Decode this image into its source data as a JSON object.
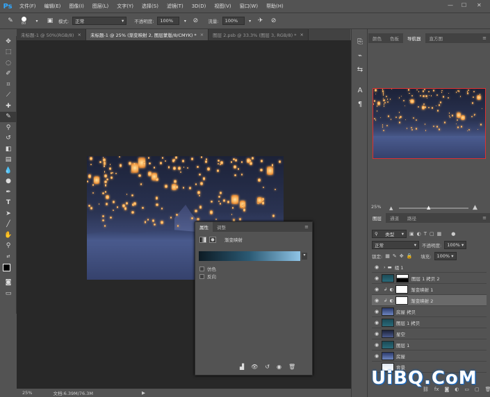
{
  "app": {
    "logo": "Ps"
  },
  "menus": [
    "文件(F)",
    "编辑(E)",
    "图像(I)",
    "图层(L)",
    "文字(Y)",
    "选择(S)",
    "滤镜(T)",
    "3D(D)",
    "视图(V)",
    "窗口(W)",
    "帮助(H)"
  ],
  "window_controls": {
    "minimize": "—",
    "maximize": "☐",
    "close": "✕"
  },
  "options": {
    "brush_size": "80",
    "mode_label": "模式:",
    "mode_value": "正常",
    "opacity_label": "不透明度:",
    "opacity_value": "100%",
    "flow_label": "流量:",
    "flow_value": "100%"
  },
  "doc_tabs": [
    {
      "label": "未标题-1 @ 50%(RGB/8)",
      "close": "×"
    },
    {
      "label": "未标题-1 @ 25% (渐变映射 2, 图层蒙版/8/CMYK) *",
      "close": "×"
    },
    {
      "label": "图层 2.psb @ 33.3% (图层 3, RGB/8) *",
      "close": "×"
    }
  ],
  "status": {
    "zoom": "25%",
    "doc_size": "文档:6.39M/76.3M",
    "arrow": "▶"
  },
  "properties": {
    "tabs": [
      "属性",
      "调整"
    ],
    "title": "渐变映射",
    "dither": "仿色",
    "reverse": "反向"
  },
  "navigator": {
    "tabs": [
      "颜色",
      "色板",
      "导航器",
      "直方图"
    ],
    "zoom": "25%"
  },
  "layers": {
    "tabs": [
      "图层",
      "通道",
      "路径"
    ],
    "filter_kind": "类型",
    "blend_mode": "正常",
    "opacity_label": "不透明度:",
    "opacity_value": "100%",
    "lock_label": "锁定:",
    "fill_label": "填充:",
    "fill_value": "100%",
    "rows": [
      {
        "name": "组 1",
        "kind": "group"
      },
      {
        "name": "图层 1 拷贝 2",
        "kind": "masked"
      },
      {
        "name": "渐变映射 1",
        "kind": "adjust"
      },
      {
        "name": "渐变映射 2",
        "kind": "adjust"
      },
      {
        "name": "房屋 拷贝",
        "kind": "layer"
      },
      {
        "name": "图层 1 拷贝",
        "kind": "layer"
      },
      {
        "name": "星空",
        "kind": "layer"
      },
      {
        "name": "图层 1",
        "kind": "layer"
      },
      {
        "name": "房屋",
        "kind": "layer"
      },
      {
        "name": "背景",
        "kind": "layer"
      }
    ]
  },
  "watermark": "UiBQ.CoM",
  "colors": {
    "accent": "#31a8ff",
    "nav_frame": "#e03030",
    "panel_bg": "#535353",
    "canvas_bg": "#282828"
  }
}
